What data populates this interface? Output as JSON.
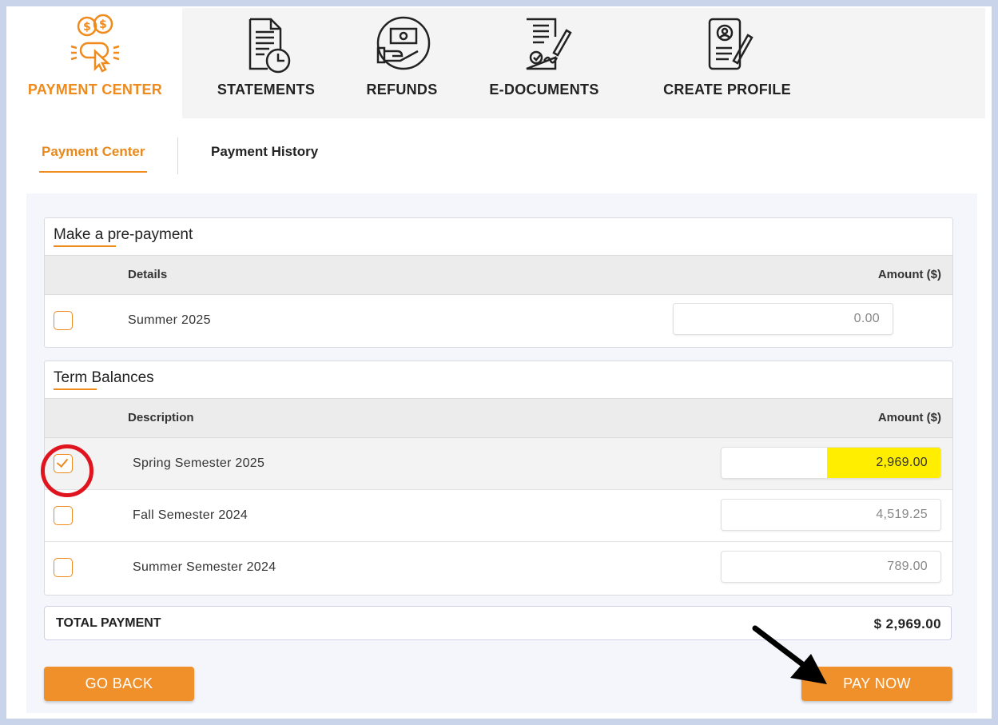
{
  "nav": {
    "tabs": [
      {
        "label": "PAYMENT CENTER",
        "icon": "payment-click-icon"
      },
      {
        "label": "STATEMENTS",
        "icon": "statement-clock-icon"
      },
      {
        "label": "REFUNDS",
        "icon": "refund-hand-icon"
      },
      {
        "label": "E-DOCUMENTS",
        "icon": "e-document-sign-icon"
      },
      {
        "label": "CREATE PROFILE",
        "icon": "profile-edit-icon"
      }
    ],
    "active": "PAYMENT CENTER"
  },
  "subtabs": [
    {
      "label": "Payment Center",
      "active": true
    },
    {
      "label": "Payment History",
      "active": false
    }
  ],
  "prepayment": {
    "title": "Make a pre-payment",
    "col_details": "Details",
    "col_amount": "Amount ($)",
    "rows": [
      {
        "label": "Summer 2025",
        "amount": "0.00",
        "checked": false
      }
    ]
  },
  "term_balances": {
    "title": "Term Balances",
    "col_description": "Description",
    "col_amount": "Amount ($)",
    "rows": [
      {
        "label": "Spring Semester 2025",
        "amount": "2,969.00",
        "checked": true
      },
      {
        "label": "Fall Semester 2024",
        "amount": "4,519.25",
        "checked": false
      },
      {
        "label": "Summer Semester 2024",
        "amount": "789.00",
        "checked": false
      }
    ]
  },
  "total": {
    "label": "TOTAL PAYMENT",
    "value": "$ 2,969.00"
  },
  "buttons": {
    "back": "GO BACK",
    "pay": "PAY NOW"
  },
  "colors": {
    "accent": "#ef8a1d",
    "highlight": "#ffee00",
    "annotation_circle": "#e0141e"
  }
}
